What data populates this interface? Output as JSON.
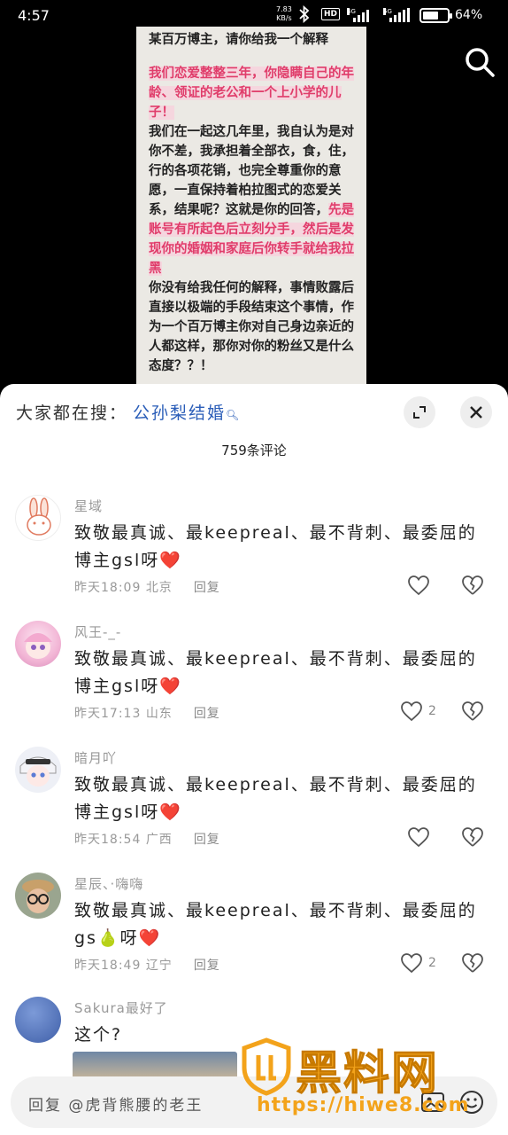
{
  "status_bar": {
    "time": "4:57",
    "net_rate_value": "7.83",
    "net_rate_unit": "KB/s",
    "hd_badge": "HD",
    "sim1_label": "4G",
    "sim2_label": "5G",
    "battery_percent_text": "64%",
    "battery_level": 0.64
  },
  "post": {
    "title": "某百万博主，请你给我一个解释",
    "highlight_1": "我们恋爱整整三年，你隐瞒自己的年龄、领证的老公和一个上小学的儿子！",
    "para_2_plain": "我们在一起这几年里，我自认为是对你不差，我承担着全部衣，食，住，行的各项花销，也完全尊重你的意愿，一直保持着柏拉图式的恋爱关系，结果呢？这就是你的回答，",
    "para_2_highlight": "先是账号有所起色后立刻分手，然后是发现你的婚姻和家庭后你转手就给我拉黑",
    "para_3": "你没有给我任何的解释，事情败露后直接以极端的手段结束这个事情，作为一个百万博主你对自己身边亲近的人都这样，那你对你的粉丝又是什么态度？？！"
  },
  "sheet": {
    "search_prefix": "大家都在搜：",
    "trending_term": "公孙梨结婚",
    "comment_count": "759条评论"
  },
  "comments": [
    {
      "name": "星域",
      "text": "致敬最真诚、最keepreal、最不背刺、最委屈的博主gsl呀",
      "emoji": "❤️",
      "time": "昨天18:09",
      "region": "北京",
      "reply": "回复",
      "likes": ""
    },
    {
      "name": "风王-_-",
      "text": "致敬最真诚、最keepreal、最不背刺、最委屈的博主gsl呀",
      "emoji": "❤️",
      "time": "昨天17:13",
      "region": "山东",
      "reply": "回复",
      "likes": "2"
    },
    {
      "name": "暗月吖",
      "text": "致敬最真诚、最keepreal、最不背刺、最委屈的博主gsl呀",
      "emoji": "❤️",
      "time": "昨天18:54",
      "region": "广西",
      "reply": "回复",
      "likes": ""
    },
    {
      "name": "星辰、·嗨嗨",
      "text": "致敬最真诚、最keepreal、最不背刺、最委屈的gs🍐呀",
      "emoji": "❤️",
      "time": "昨天18:49",
      "region": "辽宁",
      "reply": "回复",
      "likes": "2"
    },
    {
      "name": "Sakura最好了",
      "text": "这个?",
      "emoji": "",
      "time": "",
      "region": "",
      "reply": "",
      "likes": ""
    }
  ],
  "reply_bar": {
    "placeholder": "回复 @虎背熊腰的老王"
  },
  "watermark": {
    "name": "黑料网",
    "url": "https://hiwe8.com"
  },
  "colors": {
    "highlight_text": "#e03d6b",
    "link_blue": "#2a5db8",
    "heart_red": "#e0202a",
    "watermark_orange": "#f3a31b"
  }
}
